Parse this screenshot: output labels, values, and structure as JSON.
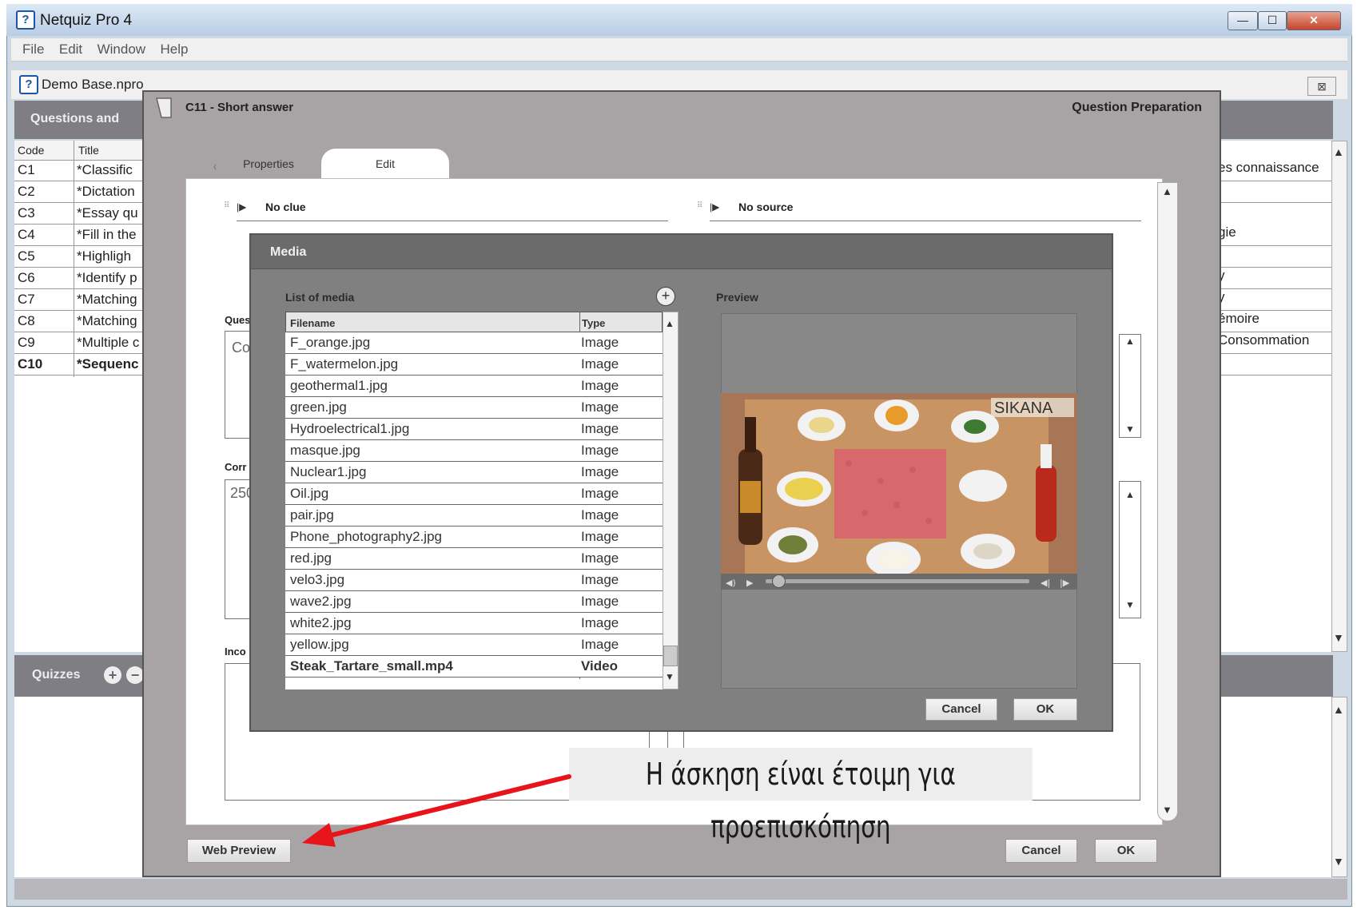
{
  "app": {
    "title": "Netquiz Pro 4",
    "window_buttons": {
      "minimize": "—",
      "maximize": "☐",
      "close": "✕"
    },
    "menu": [
      "File",
      "Edit",
      "Window",
      "Help"
    ],
    "document_title": "Demo Base.npro",
    "document_close": "⊠"
  },
  "questions_panel": {
    "header": "Questions and",
    "columns": [
      "Code",
      "Title"
    ],
    "rows": [
      {
        "code": "C1",
        "title": "*Classific"
      },
      {
        "code": "C2",
        "title": "*Dictation"
      },
      {
        "code": "C3",
        "title": "*Essay qu"
      },
      {
        "code": "C4",
        "title": "*Fill in the"
      },
      {
        "code": "C5",
        "title": "*Highligh"
      },
      {
        "code": "C6",
        "title": "*Identify p"
      },
      {
        "code": "C7",
        "title": "*Matching"
      },
      {
        "code": "C8",
        "title": "*Matching"
      },
      {
        "code": "C9",
        "title": "*Multiple c"
      },
      {
        "code": "C10",
        "title": "*Sequenc"
      }
    ],
    "right_column_rows": [
      "es connaissance",
      "",
      "gie",
      "",
      "y",
      "y",
      "émoire",
      "Consommation",
      ""
    ]
  },
  "quizzes_panel": {
    "header": "Quizzes",
    "add_icon": "+",
    "remove_icon": "−"
  },
  "question_dialog": {
    "title": "C11 - Short answer",
    "header_right": "Question Preparation",
    "tabs": [
      "Properties",
      "Edit"
    ],
    "active_tab": "Edit",
    "clue_label": "No clue",
    "source_label": "No source",
    "field_labels": {
      "question": "Ques",
      "correct": "Corr",
      "incorrect": "Inco"
    },
    "field_values": {
      "question": "Co",
      "correct": "250"
    },
    "web_preview_button": "Web Preview",
    "cancel_button": "Cancel",
    "ok_button": "OK"
  },
  "media_dialog": {
    "title": "Media",
    "list_label": "List of media",
    "preview_label": "Preview",
    "columns": [
      "Filename",
      "Type"
    ],
    "files": [
      {
        "name": "F_orange.jpg",
        "type": "Image"
      },
      {
        "name": "F_watermelon.jpg",
        "type": "Image"
      },
      {
        "name": "geothermal1.jpg",
        "type": "Image"
      },
      {
        "name": "green.jpg",
        "type": "Image"
      },
      {
        "name": "Hydroelectrical1.jpg",
        "type": "Image"
      },
      {
        "name": "masque.jpg",
        "type": "Image"
      },
      {
        "name": "Nuclear1.jpg",
        "type": "Image"
      },
      {
        "name": "Oil.jpg",
        "type": "Image"
      },
      {
        "name": "pair.jpg",
        "type": "Image"
      },
      {
        "name": "Phone_photography2.jpg",
        "type": "Image"
      },
      {
        "name": "red.jpg",
        "type": "Image"
      },
      {
        "name": "velo3.jpg",
        "type": "Image"
      },
      {
        "name": "wave2.jpg",
        "type": "Image"
      },
      {
        "name": "white2.jpg",
        "type": "Image"
      },
      {
        "name": "yellow.jpg",
        "type": "Image"
      },
      {
        "name": "Steak_Tartare_small.mp4",
        "type": "Video"
      }
    ],
    "selected_file": "Steak_Tartare_small.mp4",
    "video_watermark": "SIKANA",
    "playback_position": 0.05,
    "cancel_button": "Cancel",
    "ok_button": "OK"
  },
  "annotation": {
    "callout_text": "Η άσκηση είναι έτοιμη για προεπισκόπηση",
    "arrow_color": "#e8141b"
  },
  "colors": {
    "dialog_gray": "#a8a3a5",
    "media_gray": "#808080",
    "titlebar_blue": "#c7d8ec"
  }
}
